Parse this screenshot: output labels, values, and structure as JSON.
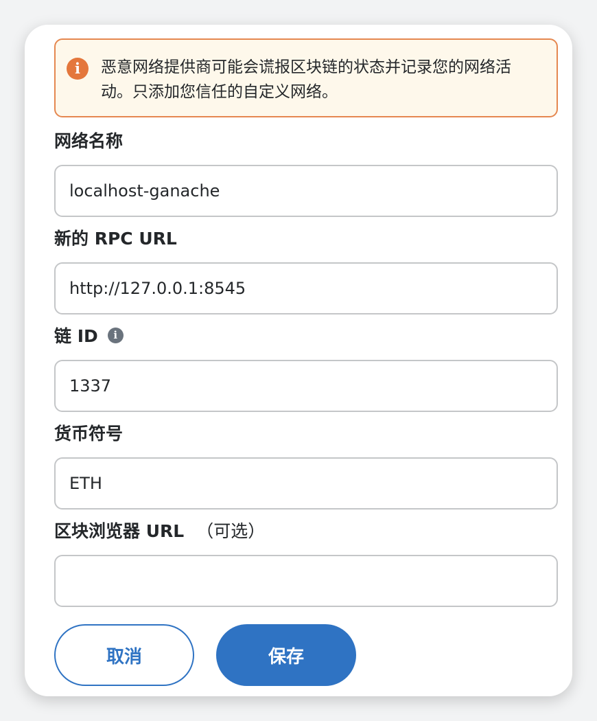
{
  "warning": {
    "icon": "info-icon",
    "text": "恶意网络提供商可能会谎报区块链的状态并记录您的网络活动。只添加您信任的自定义网络。"
  },
  "fields": {
    "network_name": {
      "label": "网络名称",
      "value": "localhost-ganache"
    },
    "rpc_url": {
      "label": "新的 RPC URL",
      "value": "http://127.0.0.1:8545"
    },
    "chain_id": {
      "label": "链 ID",
      "value": "1337",
      "info_icon": "i"
    },
    "currency_symbol": {
      "label": "货币符号",
      "value": "ETH"
    },
    "block_explorer": {
      "label": "区块浏览器 URL",
      "optional": "（可选）",
      "value": ""
    }
  },
  "buttons": {
    "cancel": "取消",
    "save": "保存"
  },
  "colors": {
    "primary": "#2f73c3",
    "warning_border": "#e5874f",
    "warning_bg": "#fef8eb",
    "warning_icon": "#e4773c"
  }
}
